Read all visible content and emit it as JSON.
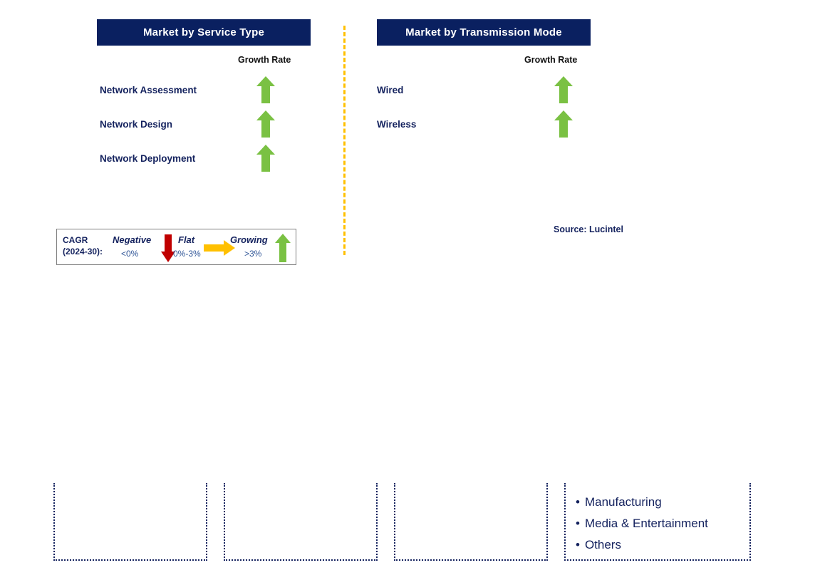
{
  "colors": {
    "header_bg": "#0A2060",
    "header_text": "#FFFFFF",
    "label_text": "#14225E",
    "growing_arrow": "#7AC143",
    "negative_arrow": "#C00000",
    "flat_arrow": "#FFC000",
    "divider": "#FFC000",
    "legend_border": "#808080"
  },
  "panels": [
    {
      "title": "Market by Service Type",
      "growth_rate_caption": "Growth Rate",
      "rows": [
        {
          "label": "Network Assessment",
          "trend": "growing",
          "arrow_icon": "arrow-up-icon"
        },
        {
          "label": "Network Design",
          "trend": "growing",
          "arrow_icon": "arrow-up-icon"
        },
        {
          "label": "Network Deployment",
          "trend": "growing",
          "arrow_icon": "arrow-up-icon"
        }
      ]
    },
    {
      "title": "Market by Transmission Mode",
      "growth_rate_caption": "Growth Rate",
      "rows": [
        {
          "label": "Wired",
          "trend": "growing",
          "arrow_icon": "arrow-up-icon"
        },
        {
          "label": "Wireless",
          "trend": "growing",
          "arrow_icon": "arrow-up-icon"
        }
      ]
    }
  ],
  "legend": {
    "title_line1": "CAGR",
    "title_line2": "(2024-30):",
    "items": [
      {
        "word": "Negative",
        "value": "<0%",
        "arrow_icon": "arrow-down-icon"
      },
      {
        "word": "Flat",
        "value": "0%-3%",
        "arrow_icon": "arrow-right-icon"
      },
      {
        "word": "Growing",
        "value": ">3%",
        "arrow_icon": "arrow-up-icon"
      }
    ]
  },
  "source_note": "Source: Lucintel",
  "bottom_boxes": [
    {
      "items": []
    },
    {
      "items": []
    },
    {
      "items": []
    },
    {
      "items": [
        "Manufacturing",
        "Media & Entertainment",
        "Others"
      ]
    }
  ]
}
